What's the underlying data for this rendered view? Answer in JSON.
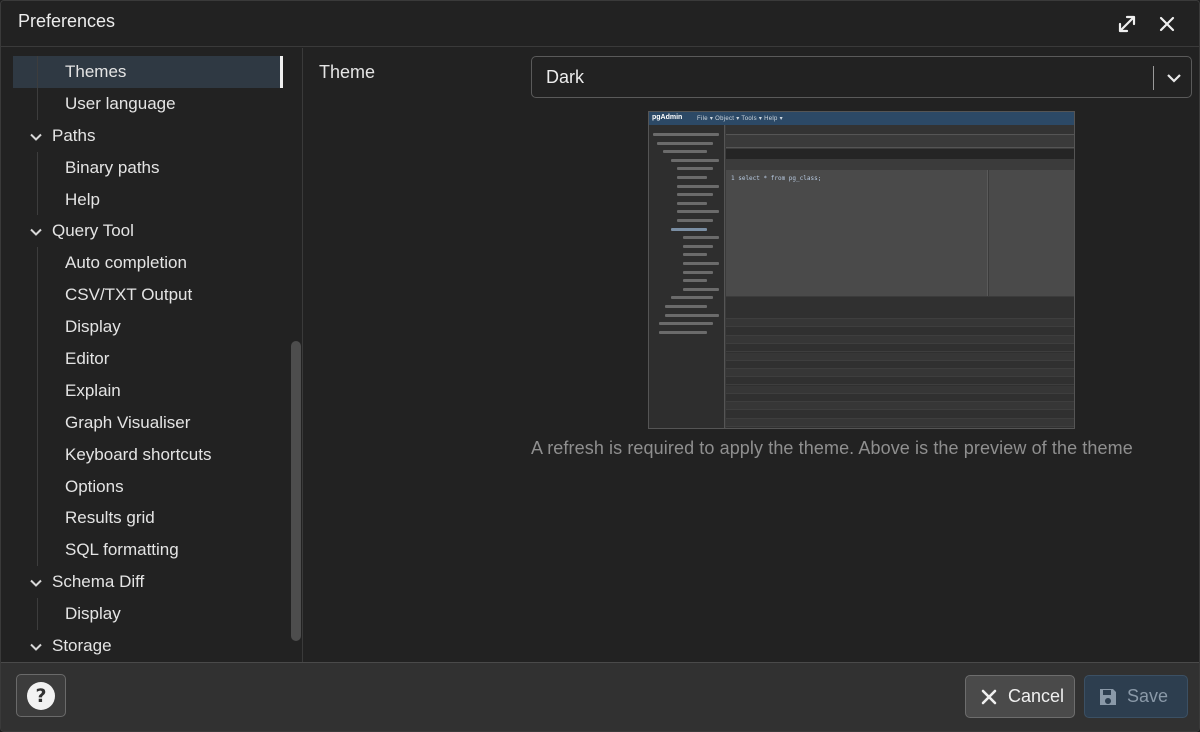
{
  "dialog": {
    "title": "Preferences",
    "maximize_icon": "expand-icon",
    "close_icon": "close-icon"
  },
  "sidebar": {
    "items": [
      {
        "label": "Themes",
        "level": "child",
        "selected": true
      },
      {
        "label": "User language",
        "level": "child"
      },
      {
        "label": "Paths",
        "level": "parent",
        "expanded": true
      },
      {
        "label": "Binary paths",
        "level": "child"
      },
      {
        "label": "Help",
        "level": "child"
      },
      {
        "label": "Query Tool",
        "level": "parent",
        "expanded": true
      },
      {
        "label": "Auto completion",
        "level": "child"
      },
      {
        "label": "CSV/TXT Output",
        "level": "child"
      },
      {
        "label": "Display",
        "level": "child"
      },
      {
        "label": "Editor",
        "level": "child"
      },
      {
        "label": "Explain",
        "level": "child"
      },
      {
        "label": "Graph Visualiser",
        "level": "child"
      },
      {
        "label": "Keyboard shortcuts",
        "level": "child"
      },
      {
        "label": "Options",
        "level": "child"
      },
      {
        "label": "Results grid",
        "level": "child"
      },
      {
        "label": "SQL formatting",
        "level": "child"
      },
      {
        "label": "Schema Diff",
        "level": "parent",
        "expanded": true
      },
      {
        "label": "Display",
        "level": "child"
      },
      {
        "label": "Storage",
        "level": "parent",
        "expanded": true
      }
    ]
  },
  "content": {
    "theme_label": "Theme",
    "theme_value": "Dark",
    "preview_logo": "pgAdmin",
    "preview_menu": "File ▾   Object ▾   Tools ▾   Help ▾",
    "preview_code": "1  select * from pg_class;",
    "hint": "A refresh is required to apply the theme. Above is the preview of the theme"
  },
  "footer": {
    "help_glyph": "?",
    "cancel_label": "Cancel",
    "save_label": "Save"
  },
  "colors": {
    "background": "#222222",
    "selected_row": "#2f3943",
    "save_button": "#2d3e4f",
    "hint_text": "#8f8f8f"
  }
}
